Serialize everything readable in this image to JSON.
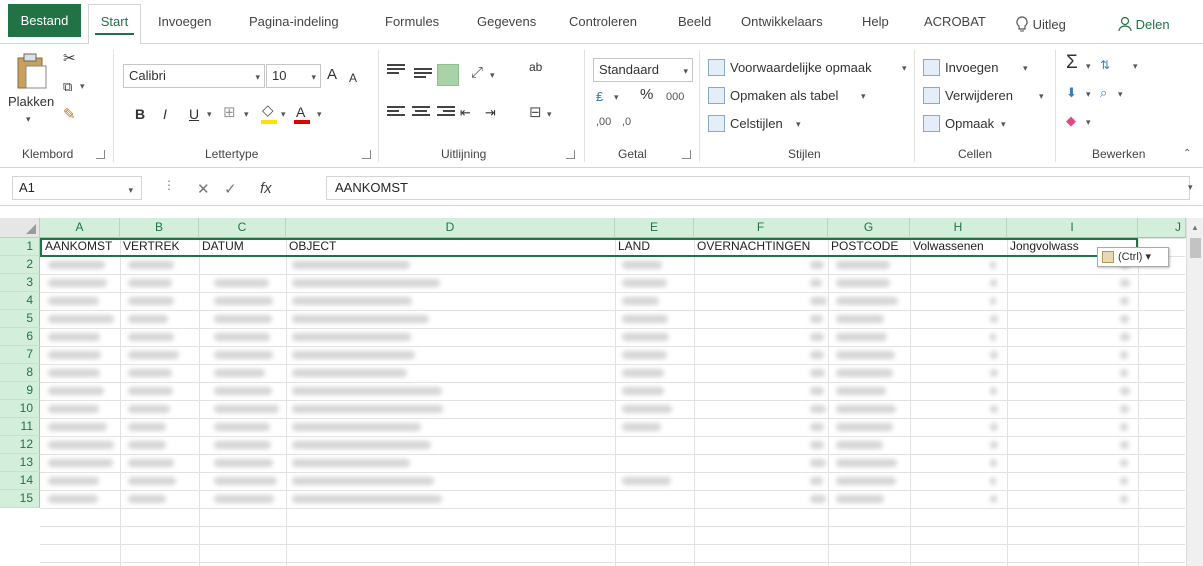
{
  "tabs": [
    "Bestand",
    "Start",
    "Invoegen",
    "Pagina-indeling",
    "Formules",
    "Gegevens",
    "Controleren",
    "Beeld",
    "Ontwikkelaars",
    "Help",
    "ACROBAT"
  ],
  "tell_me": "Uitleg",
  "share": "Delen",
  "ribbon": {
    "clipboard": {
      "paste": "Plakken",
      "label": "Klembord"
    },
    "font": {
      "name": "Calibri",
      "size": "10",
      "bold": "B",
      "italic": "I",
      "underline": "U",
      "grow": "A",
      "shrink": "A",
      "color": "A",
      "label": "Lettertype"
    },
    "alignment": {
      "label": "Uitlijning",
      "wrap": "ab"
    },
    "number": {
      "format": "Standaard",
      "percent": "%",
      "thousands": "000",
      "inc": ",00",
      "dec": ",0",
      "label": "Getal"
    },
    "styles": {
      "conditional": "Voorwaardelijke opmaak",
      "as_table": "Opmaken als tabel",
      "cell_styles": "Celstijlen",
      "label": "Stijlen"
    },
    "cells": {
      "insert": "Invoegen",
      "delete": "Verwijderen",
      "format": "Opmaak",
      "label": "Cellen"
    },
    "editing": {
      "sum": "Σ",
      "label": "Bewerken"
    }
  },
  "formula_bar": {
    "name_box": "A1",
    "cancel": "✕",
    "enter": "✓",
    "fx": "fx",
    "content": "AANKOMST"
  },
  "grid": {
    "columns": [
      "A",
      "B",
      "C",
      "D",
      "E",
      "F",
      "G",
      "H",
      "I",
      "J"
    ],
    "rows": [
      "1",
      "2",
      "3",
      "4",
      "5",
      "6",
      "7",
      "8",
      "9",
      "10",
      "11",
      "12",
      "13",
      "14",
      "15"
    ],
    "headers": [
      "AANKOMST",
      "VERTREK",
      "DATUM",
      "OBJECT",
      "LAND",
      "OVERNACHTINGEN",
      "POSTCODE",
      "Volwassenen",
      "Jongvolwass"
    ],
    "paste_options": "(Ctrl)"
  },
  "colors": {
    "accent": "#217346",
    "header_bg": "#d3efdc"
  }
}
